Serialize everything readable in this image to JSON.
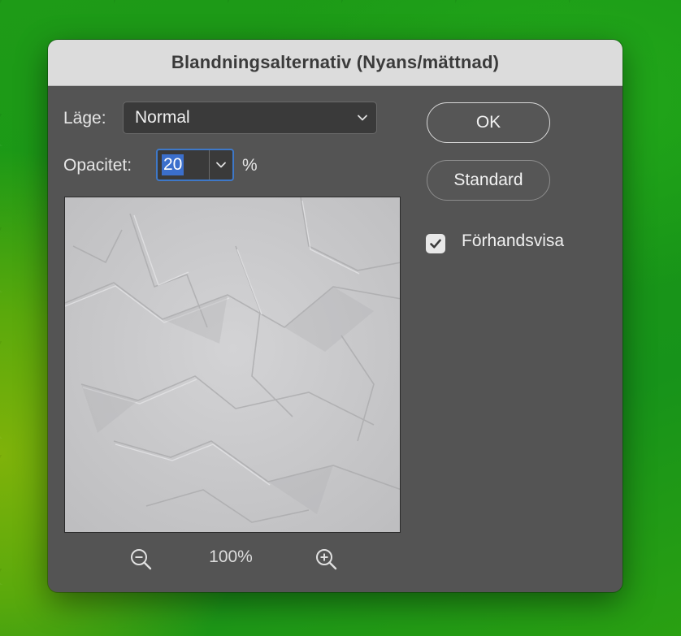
{
  "dialog": {
    "title": "Blandningsalternativ (Nyans/mättnad)",
    "mode": {
      "label": "Läge:",
      "value": "Normal"
    },
    "opacity": {
      "label": "Opacitet:",
      "value": "20",
      "unit": "%"
    },
    "zoom": {
      "level": "100%"
    },
    "buttons": {
      "ok": "OK",
      "default": "Standard"
    },
    "preview_toggle": {
      "label": "Förhandsvisa",
      "checked": true
    }
  },
  "icons": {
    "mode_dropdown": "chevron-down-icon",
    "opacity_dropdown": "chevron-down-icon",
    "zoom_out": "zoom-out-icon",
    "zoom_in": "zoom-in-icon",
    "checkbox": "checkmark-icon"
  },
  "colors": {
    "dialog_bg": "#545454",
    "titlebar_bg": "#dcdcdc",
    "focus_accent": "#3e78c8",
    "selection_bg": "#3b6fcc"
  }
}
